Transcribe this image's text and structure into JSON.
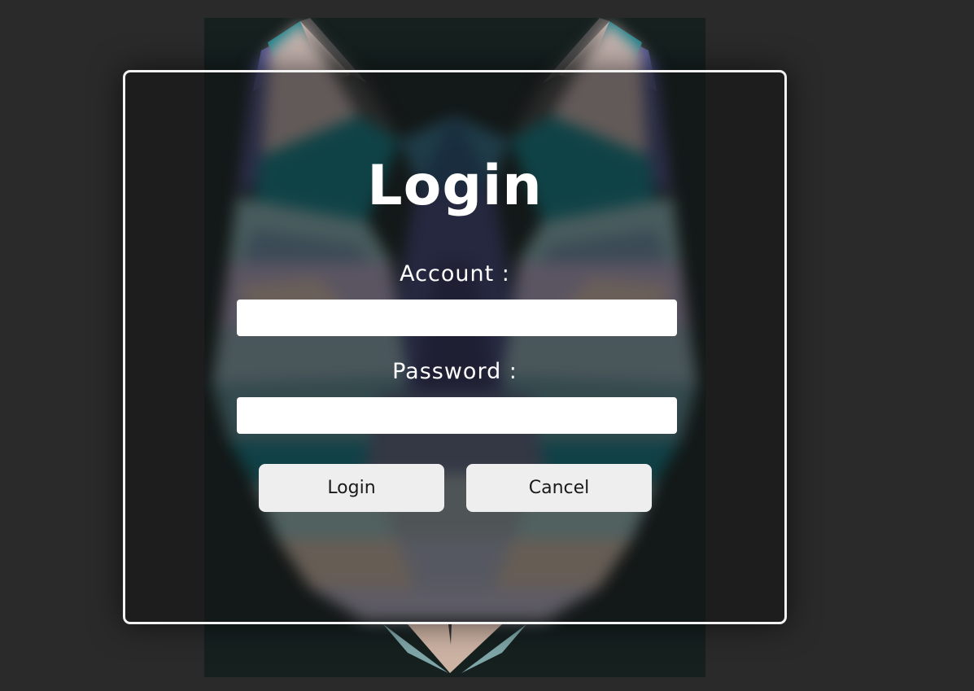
{
  "login_dialog": {
    "title": "Login",
    "account": {
      "label": "Account :",
      "value": "",
      "placeholder": ""
    },
    "password": {
      "label": "Password :",
      "value": "",
      "placeholder": ""
    },
    "buttons": {
      "login_label": "Login",
      "cancel_label": "Cancel"
    }
  },
  "background": {
    "image": "geometric-wolf-poster",
    "page_color": "#2a2a2a",
    "poster_base_color": "#15201f"
  },
  "colors": {
    "modal_border": "#f2f2f2",
    "text": "#ffffff",
    "button_bg": "#eeeeee",
    "button_text": "#1a1a1a",
    "input_bg": "#ffffff"
  }
}
